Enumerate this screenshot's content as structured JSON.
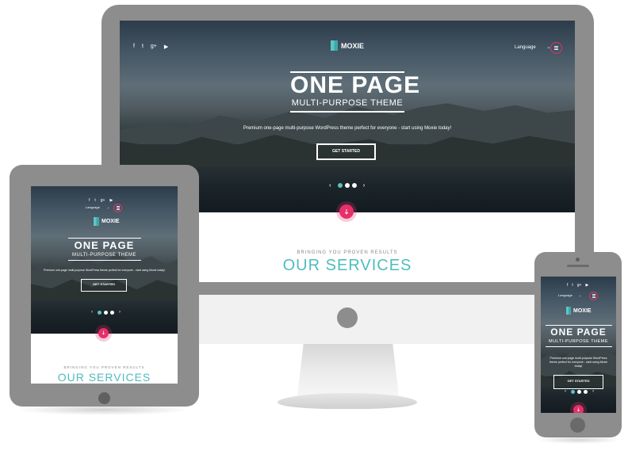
{
  "brand": "MOXIE",
  "hero": {
    "title": "ONE PAGE",
    "subtitle": "MULTI-PURPOSE THEME",
    "tagline_desktop": "Premium one-page multi-purpose WordPress theme perfect for everyone - start using Moxie today!",
    "tagline_tablet": "Premium one-page multi-purpose WordPress theme perfect for everyone - start using Moxie today!",
    "tagline_phone": "Premium one-page multi-purpose WordPress theme perfect for everyone - start using Moxie today!",
    "cta_label": "GET STARTED",
    "prev_arrow": "‹",
    "next_arrow": "›",
    "scroll_icon": "⇣"
  },
  "nav": {
    "language_label": "Language",
    "language_caret": "⌄",
    "social": [
      "f",
      "t",
      "g+",
      "▶"
    ]
  },
  "services": {
    "kicker": "BRINGING YOU PROVEN RESULTS",
    "title": "OUR SERVICES",
    "title_visible_desktop": "OUR SERVICES"
  },
  "colors": {
    "accent_teal": "#4fbcbc",
    "accent_pink": "#e7306a",
    "device_gray": "#8d8d8d"
  },
  "icons": {
    "facebook": "facebook-icon",
    "twitter": "twitter-icon",
    "google_plus": "google-plus-icon",
    "youtube": "youtube-icon",
    "menu": "hamburger-menu-icon",
    "scroll_down": "arrow-down-icon"
  }
}
